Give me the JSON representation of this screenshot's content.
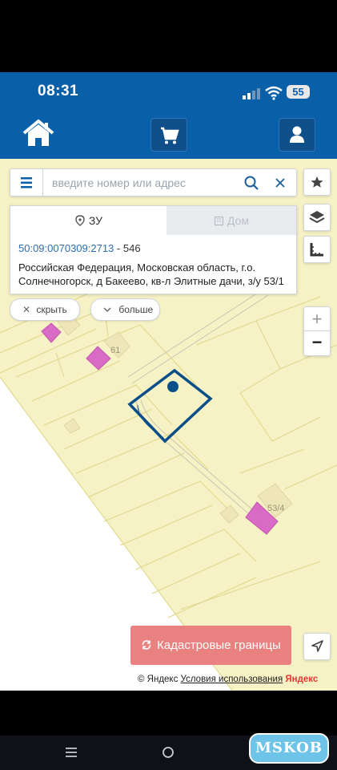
{
  "status_bar": {
    "time": "08:31",
    "battery": "55"
  },
  "header": {
    "home": "home-icon",
    "cart": "cart-icon",
    "user": "user-icon"
  },
  "search": {
    "placeholder": "введите номер или адрес"
  },
  "info": {
    "tab_zu": "ЗУ",
    "tab_dom": "Дом",
    "cadastral_number": "50:09:0070309:2713",
    "separator": " - ",
    "area": "546",
    "address": "Российская Федерация, Московская область, г.о. Солнечногорск, д Бакеево, кв-л Элитные дачи, з/у 53/1"
  },
  "chips": {
    "hide": "скрыть",
    "more": "больше"
  },
  "map": {
    "labels": [
      "61",
      "53/4"
    ],
    "highlight_color": "#0b4f8a",
    "building_color": "#d96bc6"
  },
  "zoom": {
    "in": "+",
    "out": "−"
  },
  "cadastral_button": "Кадастровые границы",
  "attribution": {
    "copyright": "© Яндекс",
    "terms": "Условия использования",
    "logo": "Яндекс"
  },
  "watermark": "MSKOB",
  "colors": {
    "header": "#0a60a8",
    "cadastral_button": "#e98180",
    "map_bg": "#f7f2c6"
  }
}
